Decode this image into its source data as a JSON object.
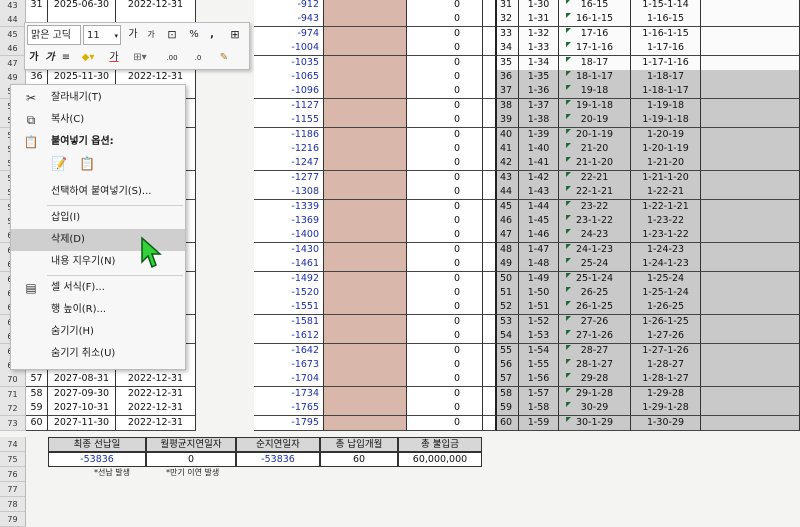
{
  "mini_toolbar": {
    "font_name": "맑은 고딕",
    "font_size": "11",
    "grow_font": "가",
    "shrink_font": "가",
    "percent": "%",
    "comma": ",",
    "bold": "가",
    "italic": "가",
    "align": "≡",
    "font_color": "가",
    "decimal_inc": ".00",
    "decimal_dec": ".0"
  },
  "context_menu": {
    "items": [
      {
        "label": "잘라내기(T)",
        "icon": "scissors-icon"
      },
      {
        "label": "복사(C)",
        "icon": "copy-icon"
      },
      {
        "label": "붙여넣기 옵션:",
        "icon": "paste-icon"
      },
      {
        "label": "선택하여 붙여넣기(S)...",
        "icon": ""
      },
      {
        "label": "삽입(I)",
        "icon": ""
      },
      {
        "label": "삭제(D)",
        "icon": ""
      },
      {
        "label": "내용 지우기(N)",
        "icon": ""
      },
      {
        "label": "셀 서식(F)...",
        "icon": "format-cells-icon"
      },
      {
        "label": "행 높이(R)...",
        "icon": ""
      },
      {
        "label": "숨기기(H)",
        "icon": ""
      },
      {
        "label": "숨기기 취소(U)",
        "icon": ""
      }
    ],
    "highlighted": "삭제(D)"
  },
  "rows": [
    {
      "rn": "43",
      "a": "31",
      "b": "2025-06-30",
      "c": "2022-12-31",
      "e": "-912",
      "g": "0",
      "i": "31",
      "j": "1-30",
      "k": "16-15",
      "l": "1-15-1-14"
    },
    {
      "rn": "44",
      "a": "",
      "b": "",
      "c": "",
      "e": "-943",
      "g": "0",
      "i": "32",
      "j": "1-31",
      "k": "16-1-15",
      "l": "1-16-15"
    },
    {
      "rn": "45",
      "a": "",
      "b": "",
      "c": "",
      "e": "-974",
      "g": "0",
      "i": "33",
      "j": "1-32",
      "k": "17-16",
      "l": "1-16-1-15"
    },
    {
      "rn": "46",
      "a": "",
      "b": "",
      "c": "",
      "e": "-1004",
      "g": "0",
      "i": "34",
      "j": "1-33",
      "k": "17-1-16",
      "l": "1-17-16"
    },
    {
      "rn": "47",
      "a": "",
      "b": "",
      "c": "",
      "e": "-1035",
      "g": "0",
      "i": "35",
      "j": "1-34",
      "k": "18-17",
      "l": "1-17-1-16"
    },
    {
      "rn": "49",
      "a": "36",
      "b": "2025-11-30",
      "c": "2022-12-31",
      "e": "-1065",
      "g": "0",
      "i": "36",
      "j": "1-35",
      "k": "18-1-17",
      "l": "1-18-17"
    },
    {
      "rn": "50",
      "a": "",
      "b": "",
      "c": "2022-12-31",
      "e": "-1096",
      "g": "0",
      "i": "37",
      "j": "1-36",
      "k": "19-18",
      "l": "1-18-1-17"
    },
    {
      "rn": "51",
      "a": "",
      "b": "",
      "c": "2022-12-31",
      "e": "-1127",
      "g": "0",
      "i": "38",
      "j": "1-37",
      "k": "19-1-18",
      "l": "1-19-18"
    },
    {
      "rn": "52",
      "a": "",
      "b": "",
      "c": "2022-12-31",
      "e": "-1155",
      "g": "0",
      "i": "39",
      "j": "1-38",
      "k": "20-19",
      "l": "1-19-1-18"
    },
    {
      "rn": "53",
      "a": "",
      "b": "",
      "c": "2022-12-31",
      "e": "-1186",
      "g": "0",
      "i": "40",
      "j": "1-39",
      "k": "20-1-19",
      "l": "1-20-19"
    },
    {
      "rn": "54",
      "a": "",
      "b": "",
      "c": "2022-12-31",
      "e": "-1216",
      "g": "0",
      "i": "41",
      "j": "1-40",
      "k": "21-20",
      "l": "1-20-1-19"
    },
    {
      "rn": "55",
      "a": "",
      "b": "",
      "c": "2022-12-31",
      "e": "-1247",
      "g": "0",
      "i": "42",
      "j": "1-41",
      "k": "21-1-20",
      "l": "1-21-20"
    },
    {
      "rn": "56",
      "a": "",
      "b": "",
      "c": "2022-12-31",
      "e": "-1277",
      "g": "0",
      "i": "43",
      "j": "1-42",
      "k": "22-21",
      "l": "1-21-1-20"
    },
    {
      "rn": "57",
      "a": "",
      "b": "",
      "c": "2022-12-31",
      "e": "-1308",
      "g": "0",
      "i": "44",
      "j": "1-43",
      "k": "22-1-21",
      "l": "1-22-21"
    },
    {
      "rn": "58",
      "a": "",
      "b": "",
      "c": "2022-12-31",
      "e": "-1339",
      "g": "0",
      "i": "45",
      "j": "1-44",
      "k": "23-22",
      "l": "1-22-1-21"
    },
    {
      "rn": "59",
      "a": "",
      "b": "",
      "c": "2022-12-31",
      "e": "-1369",
      "g": "0",
      "i": "46",
      "j": "1-45",
      "k": "23-1-22",
      "l": "1-23-22"
    },
    {
      "rn": "60",
      "a": "",
      "b": "",
      "c": "2022-12-31",
      "e": "-1400",
      "g": "0",
      "i": "47",
      "j": "1-46",
      "k": "24-23",
      "l": "1-23-1-22"
    },
    {
      "rn": "61",
      "a": "",
      "b": "",
      "c": "2022-12-31",
      "e": "-1430",
      "g": "0",
      "i": "48",
      "j": "1-47",
      "k": "24-1-23",
      "l": "1-24-23"
    },
    {
      "rn": "62",
      "a": "",
      "b": "",
      "c": "2022-12-31",
      "e": "-1461",
      "g": "0",
      "i": "49",
      "j": "1-48",
      "k": "25-24",
      "l": "1-24-1-23"
    },
    {
      "rn": "63",
      "a": "",
      "b": "",
      "c": "2022-12-31",
      "e": "-1492",
      "g": "0",
      "i": "50",
      "j": "1-49",
      "k": "25-1-24",
      "l": "1-25-24"
    },
    {
      "rn": "64",
      "a": "",
      "b": "",
      "c": "2022-12-31",
      "e": "-1520",
      "g": "0",
      "i": "51",
      "j": "1-50",
      "k": "26-25",
      "l": "1-25-1-24"
    },
    {
      "rn": "65",
      "a": "",
      "b": "",
      "c": "2022-12-31",
      "e": "-1551",
      "g": "0",
      "i": "52",
      "j": "1-51",
      "k": "26-1-25",
      "l": "1-26-25"
    },
    {
      "rn": "66",
      "a": "",
      "b": "",
      "c": "2022-12-31",
      "e": "-1581",
      "g": "0",
      "i": "53",
      "j": "1-52",
      "k": "27-26",
      "l": "1-26-1-25"
    },
    {
      "rn": "67",
      "a": "",
      "b": "",
      "c": "2022-12-31",
      "e": "-1612",
      "g": "0",
      "i": "54",
      "j": "1-53",
      "k": "27-1-26",
      "l": "1-27-26"
    },
    {
      "rn": "68",
      "a": "",
      "b": "",
      "c": "2022-12-31",
      "e": "-1642",
      "g": "0",
      "i": "55",
      "j": "1-54",
      "k": "28-27",
      "l": "1-27-1-26"
    },
    {
      "rn": "69",
      "a": "",
      "b": "2027-07-31",
      "c": "2022-12-31",
      "e": "-1673",
      "g": "0",
      "i": "56",
      "j": "1-55",
      "k": "28-1-27",
      "l": "1-28-27"
    },
    {
      "rn": "70",
      "a": "57",
      "b": "2027-08-31",
      "c": "2022-12-31",
      "e": "-1704",
      "g": "0",
      "i": "57",
      "j": "1-56",
      "k": "29-28",
      "l": "1-28-1-27"
    },
    {
      "rn": "71",
      "a": "58",
      "b": "2027-09-30",
      "c": "2022-12-31",
      "e": "-1734",
      "g": "0",
      "i": "58",
      "j": "1-57",
      "k": "29-1-28",
      "l": "1-29-28"
    },
    {
      "rn": "72",
      "a": "59",
      "b": "2027-10-31",
      "c": "2022-12-31",
      "e": "-1765",
      "g": "0",
      "i": "59",
      "j": "1-58",
      "k": "30-29",
      "l": "1-29-1-28"
    },
    {
      "rn": "73",
      "a": "60",
      "b": "2027-11-30",
      "c": "2022-12-31",
      "e": "-1795",
      "g": "0",
      "i": "60",
      "j": "1-59",
      "k": "30-1-29",
      "l": "1-30-29"
    }
  ],
  "summary": {
    "headers": [
      "최종 선납일",
      "월평균지연일자",
      "순지연일자",
      "총 납입개월",
      "총 불입금"
    ],
    "values": [
      "-53836",
      "0",
      "-53836",
      "60",
      "60,000,000"
    ],
    "notes": [
      "*선납 발생",
      "*만기 이연 발생"
    ],
    "trailing_rownums": [
      "74",
      "75",
      "76",
      "77",
      "78",
      "79"
    ]
  }
}
